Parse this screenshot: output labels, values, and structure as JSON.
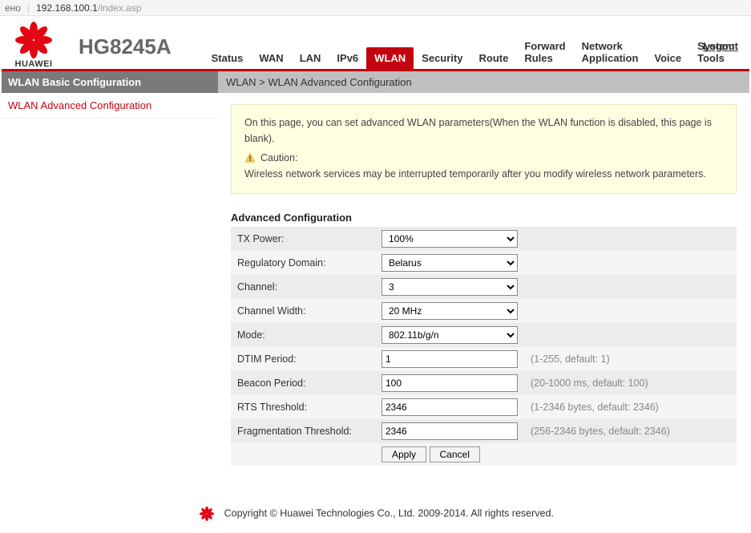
{
  "browser": {
    "left_text": "ено",
    "url_host": "192.168.100.1",
    "url_path": "/index.asp"
  },
  "brand": {
    "logo_label": "HUAWEI",
    "model": "HG8245A",
    "logout": "Logout"
  },
  "nav": {
    "items": [
      "Status",
      "WAN",
      "LAN",
      "IPv6",
      "WLAN",
      "Security",
      "Route",
      "Forward Rules",
      "Network Application",
      "Voice",
      "System Tools"
    ],
    "active_index": 4
  },
  "sidebar": {
    "header": "WLAN Basic Configuration",
    "items": [
      "WLAN Advanced Configuration"
    ],
    "current_index": 0
  },
  "breadcrumb": "WLAN > WLAN Advanced Configuration",
  "notice": {
    "line1": "On this page, you can set advanced WLAN parameters(When the WLAN function is disabled, this page is blank).",
    "caution_label": "Caution:",
    "line2": "Wireless network services may be interrupted temporarily after you modify wireless network parameters."
  },
  "section_title": "Advanced Configuration",
  "form": {
    "tx_power": {
      "label": "TX Power:",
      "value": "100%",
      "hint": ""
    },
    "reg_domain": {
      "label": "Regulatory Domain:",
      "value": "Belarus",
      "hint": ""
    },
    "channel": {
      "label": "Channel:",
      "value": "3",
      "hint": ""
    },
    "channel_width": {
      "label": "Channel Width:",
      "value": "20 MHz",
      "hint": ""
    },
    "mode": {
      "label": "Mode:",
      "value": "802.11b/g/n",
      "hint": ""
    },
    "dtim": {
      "label": "DTIM Period:",
      "value": "1",
      "hint": "(1-255, default: 1)"
    },
    "beacon": {
      "label": "Beacon Period:",
      "value": "100",
      "hint": "(20-1000 ms, default: 100)"
    },
    "rts": {
      "label": "RTS Threshold:",
      "value": "2346",
      "hint": "(1-2346 bytes, default: 2346)"
    },
    "frag": {
      "label": "Fragmentation Threshold:",
      "value": "2346",
      "hint": "(256-2346 bytes, default: 2346)"
    }
  },
  "buttons": {
    "apply": "Apply",
    "cancel": "Cancel"
  },
  "footer": "Copyright © Huawei Technologies Co., Ltd. 2009-2014. All rights reserved."
}
